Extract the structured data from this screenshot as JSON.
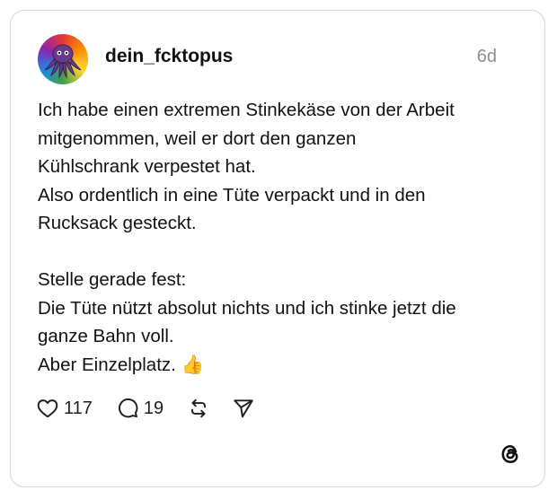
{
  "post": {
    "username": "dein_fcktopus",
    "time": "6d",
    "lines": [
      "Ich habe einen extremen Stinkekäse von der Arbeit",
      "mitgenommen, weil er dort den ganzen",
      "Kühlschrank verpestet hat.",
      "Also ordentlich in eine Tüte verpackt und in den",
      "Rucksack gesteckt.",
      "",
      "Stelle gerade fest:",
      "Die Tüte nützt absolut nichts und ich stinke jetzt die",
      "ganze Bahn voll.",
      "Aber Einzelplatz. 👍"
    ]
  },
  "actions": {
    "like_count": "117",
    "reply_count": "19"
  },
  "icons": {
    "avatar": "rainbow-octopus-avatar",
    "like": "heart-icon",
    "reply": "comment-bubble-icon",
    "repost": "repost-icon",
    "share": "send-icon",
    "brand": "threads-logo-icon"
  },
  "colors": {
    "text": "#111111",
    "muted": "#8e8e8e",
    "border": "#d6d6d6"
  }
}
